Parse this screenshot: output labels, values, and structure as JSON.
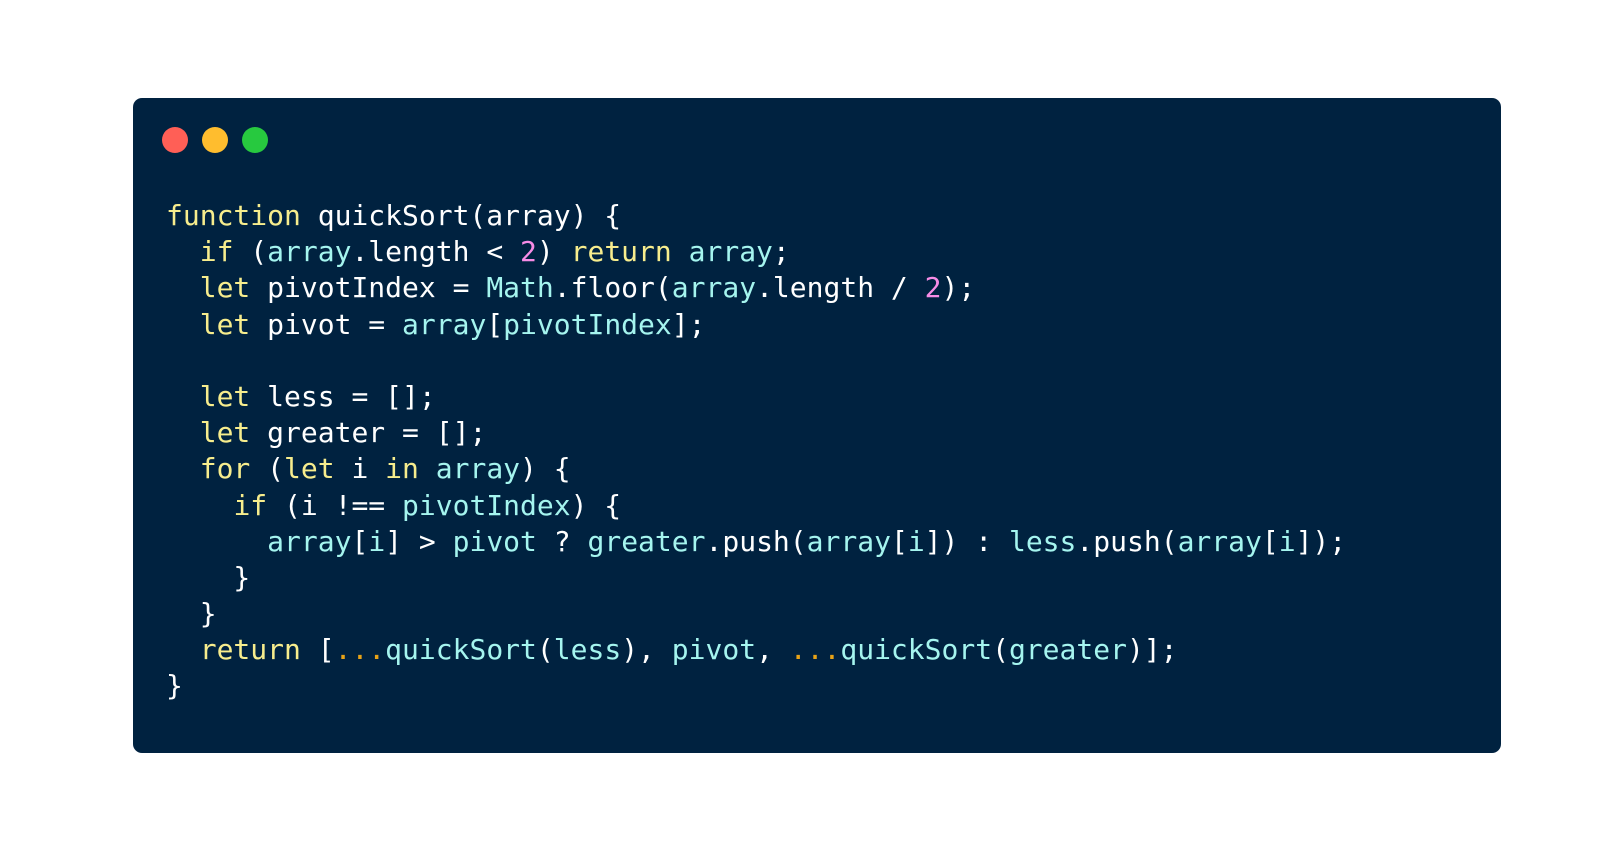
{
  "window": {
    "background": "#002240",
    "controls": [
      {
        "name": "close-dot",
        "color": "#ff5f56"
      },
      {
        "name": "minimize-dot",
        "color": "#ffbd2e"
      },
      {
        "name": "zoom-dot",
        "color": "#27c93f"
      }
    ]
  },
  "theme": {
    "keyword": "#f7ed8d",
    "identifier": "#a5f5ef",
    "number": "#f78ce6",
    "spread": "#e8a317",
    "plain": "#ffffff"
  },
  "code": {
    "language": "javascript",
    "lines": [
      [
        [
          "keyword",
          "function"
        ],
        [
          "plain",
          " quickSort(array) {"
        ]
      ],
      [
        [
          "plain",
          "  "
        ],
        [
          "keyword",
          "if"
        ],
        [
          "plain",
          " ("
        ],
        [
          "identifier",
          "array"
        ],
        [
          "plain",
          ".length < "
        ],
        [
          "number",
          "2"
        ],
        [
          "plain",
          ") "
        ],
        [
          "keyword",
          "return"
        ],
        [
          "plain",
          " "
        ],
        [
          "identifier",
          "array"
        ],
        [
          "plain",
          ";"
        ]
      ],
      [
        [
          "plain",
          "  "
        ],
        [
          "keyword",
          "let"
        ],
        [
          "plain",
          " pivotIndex = "
        ],
        [
          "identifier",
          "Math"
        ],
        [
          "plain",
          ".floor("
        ],
        [
          "identifier",
          "array"
        ],
        [
          "plain",
          ".length / "
        ],
        [
          "number",
          "2"
        ],
        [
          "plain",
          ");"
        ]
      ],
      [
        [
          "plain",
          "  "
        ],
        [
          "keyword",
          "let"
        ],
        [
          "plain",
          " pivot = "
        ],
        [
          "identifier",
          "array"
        ],
        [
          "plain",
          "["
        ],
        [
          "identifier",
          "pivotIndex"
        ],
        [
          "plain",
          "];"
        ]
      ],
      [],
      [
        [
          "plain",
          "  "
        ],
        [
          "keyword",
          "let"
        ],
        [
          "plain",
          " less = [];"
        ]
      ],
      [
        [
          "plain",
          "  "
        ],
        [
          "keyword",
          "let"
        ],
        [
          "plain",
          " greater = [];"
        ]
      ],
      [
        [
          "plain",
          "  "
        ],
        [
          "keyword",
          "for"
        ],
        [
          "plain",
          " ("
        ],
        [
          "keyword",
          "let"
        ],
        [
          "plain",
          " i "
        ],
        [
          "keyword",
          "in"
        ],
        [
          "plain",
          " "
        ],
        [
          "identifier",
          "array"
        ],
        [
          "plain",
          ") {"
        ]
      ],
      [
        [
          "plain",
          "    "
        ],
        [
          "keyword",
          "if"
        ],
        [
          "plain",
          " (i !== "
        ],
        [
          "identifier",
          "pivotIndex"
        ],
        [
          "plain",
          ") {"
        ]
      ],
      [
        [
          "plain",
          "      "
        ],
        [
          "identifier",
          "array"
        ],
        [
          "plain",
          "["
        ],
        [
          "identifier",
          "i"
        ],
        [
          "plain",
          "] > "
        ],
        [
          "identifier",
          "pivot"
        ],
        [
          "plain",
          " ? "
        ],
        [
          "identifier",
          "greater"
        ],
        [
          "plain",
          ".push("
        ],
        [
          "identifier",
          "array"
        ],
        [
          "plain",
          "["
        ],
        [
          "identifier",
          "i"
        ],
        [
          "plain",
          "]) : "
        ],
        [
          "identifier",
          "less"
        ],
        [
          "plain",
          ".push("
        ],
        [
          "identifier",
          "array"
        ],
        [
          "plain",
          "["
        ],
        [
          "identifier",
          "i"
        ],
        [
          "plain",
          "]);"
        ]
      ],
      [
        [
          "plain",
          "    }"
        ]
      ],
      [
        [
          "plain",
          "  }"
        ]
      ],
      [
        [
          "plain",
          "  "
        ],
        [
          "keyword",
          "return"
        ],
        [
          "plain",
          " ["
        ],
        [
          "spread",
          "..."
        ],
        [
          "identifier",
          "quickSort"
        ],
        [
          "plain",
          "("
        ],
        [
          "identifier",
          "less"
        ],
        [
          "plain",
          "), "
        ],
        [
          "identifier",
          "pivot"
        ],
        [
          "plain",
          ", "
        ],
        [
          "spread",
          "..."
        ],
        [
          "identifier",
          "quickSort"
        ],
        [
          "plain",
          "("
        ],
        [
          "identifier",
          "greater"
        ],
        [
          "plain",
          ")];"
        ]
      ],
      [
        [
          "plain",
          "}"
        ]
      ]
    ]
  }
}
